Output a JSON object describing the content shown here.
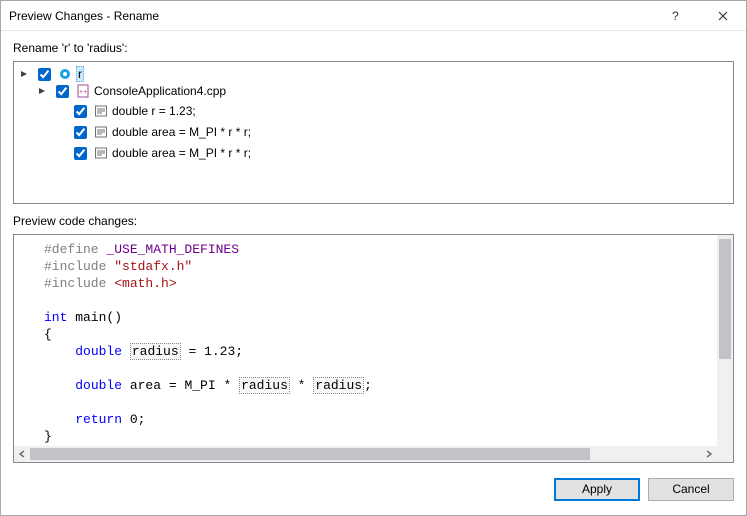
{
  "window": {
    "title": "Preview Changes - Rename"
  },
  "header": {
    "label": "Rename 'r' to 'radius':"
  },
  "tree": {
    "root": {
      "label": "r",
      "checked": true,
      "file": {
        "label": "ConsoleApplication4.cpp",
        "checked": true,
        "lines": [
          {
            "checked": true,
            "text": "double r = 1.23;"
          },
          {
            "checked": true,
            "text": "double area = M_PI * r * r;"
          },
          {
            "checked": true,
            "text": "double area = M_PI * r * r;"
          }
        ]
      }
    }
  },
  "preview": {
    "label": "Preview code changes:",
    "code": {
      "l1_pre": "#define",
      "l1_mac": " _USE_MATH_DEFINES",
      "l2_pre": "#include",
      "l2_str": " \"stdafx.h\"",
      "l3_pre": "#include",
      "l3_str": " <math.h>",
      "l4_kw_int": "int",
      "l4_rest": " main()",
      "brace_open": "{",
      "l5_kw": "double",
      "l5_sp": " ",
      "l5_id": "radius",
      "l5_rest": " = 1.23;",
      "l6_kw": "double",
      "l6_a": " area = M_PI * ",
      "l6_id1": "radius",
      "l6_mid": " * ",
      "l6_id2": "radius",
      "l6_end": ";",
      "l7_kw": "return",
      "l7_rest": " 0;",
      "brace_close": "}"
    }
  },
  "buttons": {
    "apply": "Apply",
    "cancel": "Cancel"
  }
}
